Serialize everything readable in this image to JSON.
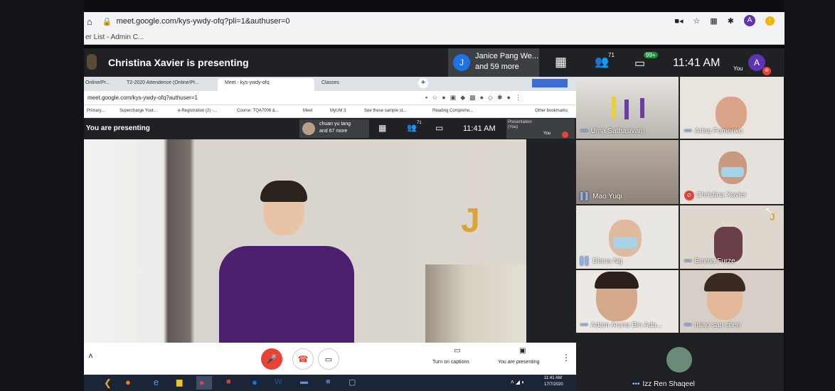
{
  "browser": {
    "url": "meet.google.com/kys-ywdy-ofq?pli=1&authuser=0",
    "bookmark": "er List - Admin C..."
  },
  "meet": {
    "presenting": "Christina Xavier is presenting",
    "avatar_j": "J",
    "people_line1": "Janice Pang We...",
    "people_line2": "and 59 more",
    "people_count": "71",
    "chat_badge": "99+",
    "time": "11:41 AM",
    "you_label": "You",
    "self_avatar": "A"
  },
  "inner": {
    "tabs": [
      "Online/Pr...",
      "T2-2020 Attendence (Online/Pr...",
      "Meet - kys-ywdy-ofq",
      "Classes"
    ],
    "url": "meet.google.com/kys-ywdy-ofq?authuser=1",
    "bookmarks": [
      "Primary...",
      "Supercharge Your...",
      "e-Registration (2) -...",
      "Course: TQA7006 &...",
      "Meet",
      "MyUM 3",
      "See these sample st...",
      "Reading Comprehe...",
      "Other bookmarks"
    ],
    "presenting": "You are presenting",
    "people_line1": "chuan yu tang",
    "people_line2": "and 67 more",
    "people_count": "71",
    "time": "11:41 AM",
    "captions": "Turn on captions",
    "you_are_presenting": "You are presenting",
    "thumb_label": "Presentation (You)",
    "thumb_you": "You",
    "taskbar_time": "11:41 AM",
    "taskbar_date": "17/7/2020"
  },
  "participants": [
    {
      "name": "Uma Sathasivam",
      "mic": "dots"
    },
    {
      "name": "Arina Fomenko",
      "mic": "dots"
    },
    {
      "name": "Mao Yuqi",
      "mic": "eq"
    },
    {
      "name": "Christina Xavier",
      "mic": "off"
    },
    {
      "name": "Diana Ng",
      "mic": "eq"
    },
    {
      "name": "Emma Furze",
      "mic": "dots"
    },
    {
      "name": "Adam Aruna Bin Ada...",
      "mic": "dots"
    },
    {
      "name": "miao san chen",
      "mic": "dots"
    },
    {
      "name": "Izz Ren Shaqeel",
      "mic": "dots"
    }
  ],
  "colors": {
    "meet_bg": "#202124",
    "accent_blue": "#1a73e8",
    "red": "#ea4335",
    "self_avatar": "#5e35b1"
  }
}
